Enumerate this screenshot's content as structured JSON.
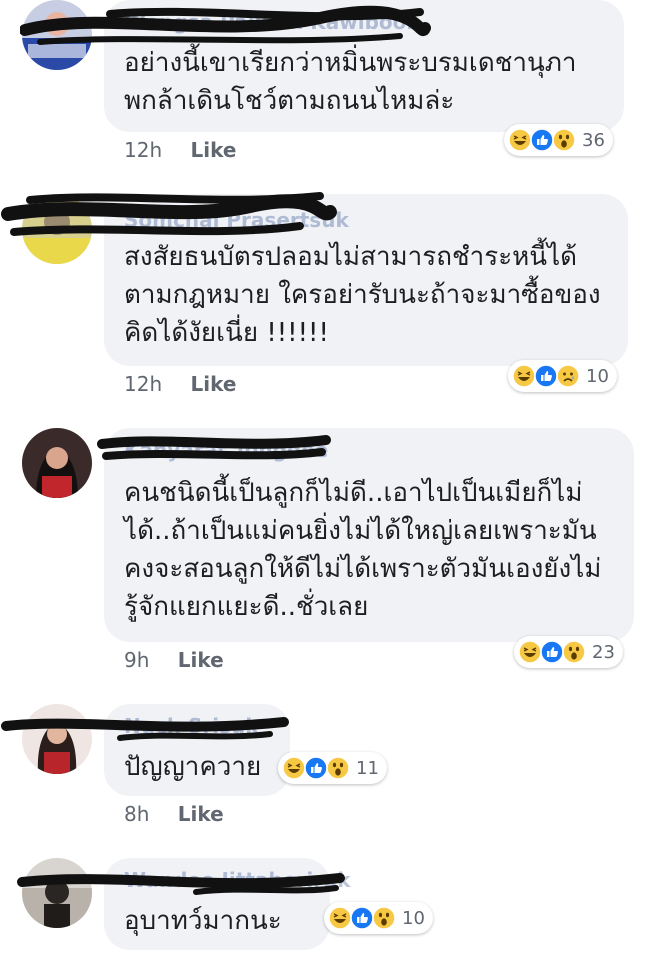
{
  "comments": [
    {
      "author": "Wongsa Pailuan Kawiboon",
      "text": [
        "อย่างนี้เขาเรียกว่าหมิ่นพระบรมเดชานุภา",
        "พกล้าเดินโชว์ตามถนนไหมล่ะ"
      ],
      "time": "12h",
      "like": "Like",
      "reactions": [
        "haha-icon",
        "like-icon",
        "wow-icon"
      ],
      "count": "36"
    },
    {
      "author": "Somchai Prasertsuk",
      "text": [
        "สงสัยธนบัตรปลอมไม่สามารถชำระหนี้ได้",
        "ตามกฎหมาย ใครอย่ารับนะถ้าจะมาซื้อของ",
        "คิดได้งัยเนี่ย !!!!!!"
      ],
      "time": "12h",
      "like": "Like",
      "reactions": [
        "haha-icon",
        "like-icon",
        "sad-icon"
      ],
      "count": "10"
    },
    {
      "author": "Kanyarat Tongdee",
      "text": [
        "คนชนิดนี้เป็นลูกก็ไม่ดี..เอาไปเป็นเมียก็ไม่",
        "ได้..ถ้าเป็นแม่คนยิ่งไม่ได้ใหญ่เลยเพราะมัน",
        "คงจะสอนลูกให้ดีไม่ได้เพราะตัวมันเองยังไม่",
        "รู้จักแยกแยะดี..ชั่วเลย"
      ],
      "time": "9h",
      "like": "Like",
      "reactions": [
        "haha-icon",
        "like-icon",
        "wow-icon"
      ],
      "count": "23"
    },
    {
      "author": "Nuch Srisuk",
      "text": [
        "ปัญญาควาย"
      ],
      "time": "8h",
      "like": "Like",
      "reactions": [
        "haha-icon",
        "like-icon",
        "wow-icon"
      ],
      "count": "11"
    },
    {
      "author": "Wandee Jittaboriruk",
      "text": [
        "อุบาทว์มากนะ"
      ],
      "time": "",
      "like": "",
      "reactions": [
        "haha-icon",
        "like-icon",
        "wow-icon"
      ],
      "count": "10"
    }
  ],
  "colors": {
    "bubble": "#f0f2f5",
    "like_blue": "#1877f2",
    "emoji_yellow": "#f7c843",
    "scribble": "#111111"
  }
}
